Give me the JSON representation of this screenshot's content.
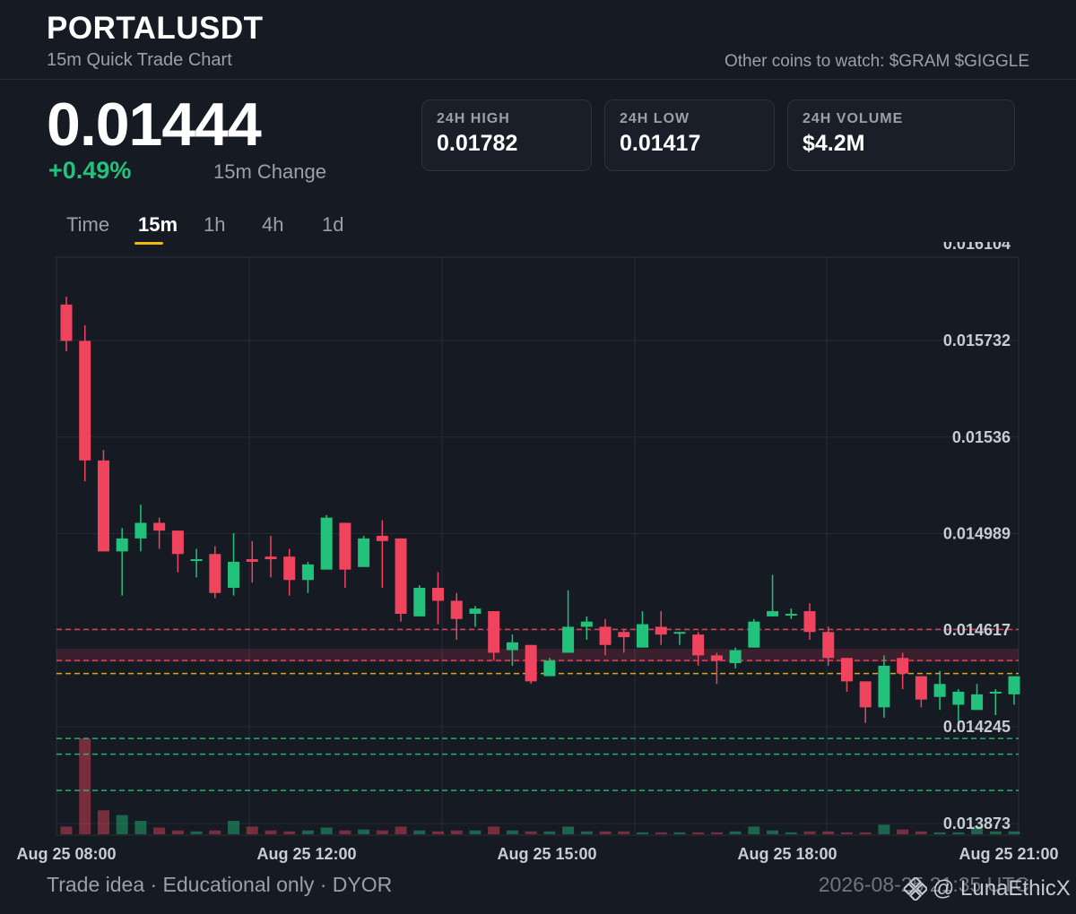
{
  "header": {
    "symbol": "PORTALUSDT",
    "subtitle": "15m Quick Trade Chart",
    "watch_text": "Other coins to watch: $GRAM $GIGGLE"
  },
  "price": {
    "last": "0.01444",
    "change": "+0.49%",
    "change_label": "15m Change"
  },
  "stats": [
    {
      "label": "24H HIGH",
      "value": "0.01782"
    },
    {
      "label": "24H LOW",
      "value": "0.01417"
    },
    {
      "label": "24H VOLUME",
      "value": "$4.2M"
    }
  ],
  "tabs": [
    {
      "label": "Time",
      "active": false
    },
    {
      "label": "15m",
      "active": true
    },
    {
      "label": "1h",
      "active": false
    },
    {
      "label": "4h",
      "active": false
    },
    {
      "label": "1d",
      "active": false
    }
  ],
  "footer": {
    "disclaimer": "Trade idea · Educational only · DYOR",
    "timestamp": "2026-08-25 21:35 UTC",
    "watermark": "@ LunaEthicX"
  },
  "colors": {
    "up": "#22c27c",
    "down": "#f0445e",
    "accent": "#f0b90b",
    "background": "#161a23"
  },
  "chart_data": {
    "type": "candlestick",
    "y_tick_labels": [
      "0.016104",
      "0.015732",
      "0.01536",
      "0.014989",
      "0.014617",
      "0.014245",
      "0.013873"
    ],
    "ylim": [
      0.013873,
      0.016104
    ],
    "grid": true,
    "x_tick_labels": [
      "Aug 25 08:00",
      "Aug 25 12:00",
      "Aug 25 15:00",
      "Aug 25 18:00",
      "Aug 25 21:00"
    ],
    "reference_lines": [
      {
        "value": 0.01462,
        "color": "#f0445e",
        "style": "dashed"
      },
      {
        "value": 0.0145,
        "color": "#f0445e",
        "style": "dashed"
      },
      {
        "value": 0.01445,
        "color": "#f0b90b",
        "style": "dashed"
      },
      {
        "value": 0.0142,
        "color": "#22c27c",
        "style": "dashed"
      },
      {
        "value": 0.01414,
        "color": "#22c27c",
        "style": "dashed"
      },
      {
        "value": 0.014,
        "color": "#22c27c",
        "style": "dashed"
      }
    ],
    "resistance_zone": [
      0.014495,
      0.014545
    ],
    "candles": [
      {
        "o": 0.01587,
        "h": 0.0159,
        "l": 0.01569,
        "c": 0.01573,
        "v": 0.08
      },
      {
        "o": 0.01573,
        "h": 0.01579,
        "l": 0.01519,
        "c": 0.01527,
        "v": 1.0
      },
      {
        "o": 0.01527,
        "h": 0.01531,
        "l": 0.01492,
        "c": 0.01492,
        "v": 0.25
      },
      {
        "o": 0.01492,
        "h": 0.01501,
        "l": 0.01475,
        "c": 0.01497,
        "v": 0.2
      },
      {
        "o": 0.01497,
        "h": 0.0151,
        "l": 0.01492,
        "c": 0.01503,
        "v": 0.14
      },
      {
        "o": 0.01503,
        "h": 0.01505,
        "l": 0.01493,
        "c": 0.015,
        "v": 0.07
      },
      {
        "o": 0.015,
        "h": 0.015,
        "l": 0.01484,
        "c": 0.01491,
        "v": 0.04
      },
      {
        "o": 0.01489,
        "h": 0.01493,
        "l": 0.01482,
        "c": 0.01489,
        "v": 0.03
      },
      {
        "o": 0.01491,
        "h": 0.01494,
        "l": 0.01474,
        "c": 0.01476,
        "v": 0.04
      },
      {
        "o": 0.01478,
        "h": 0.01499,
        "l": 0.01475,
        "c": 0.01488,
        "v": 0.14
      },
      {
        "o": 0.01489,
        "h": 0.01496,
        "l": 0.0148,
        "c": 0.01488,
        "v": 0.08
      },
      {
        "o": 0.0149,
        "h": 0.01498,
        "l": 0.01482,
        "c": 0.01489,
        "v": 0.04
      },
      {
        "o": 0.0149,
        "h": 0.01493,
        "l": 0.01475,
        "c": 0.01481,
        "v": 0.03
      },
      {
        "o": 0.01481,
        "h": 0.01488,
        "l": 0.01476,
        "c": 0.01487,
        "v": 0.04
      },
      {
        "o": 0.01485,
        "h": 0.01506,
        "l": 0.01485,
        "c": 0.01505,
        "v": 0.07
      },
      {
        "o": 0.01503,
        "h": 0.01503,
        "l": 0.01478,
        "c": 0.01485,
        "v": 0.04
      },
      {
        "o": 0.01486,
        "h": 0.01498,
        "l": 0.01486,
        "c": 0.01497,
        "v": 0.05
      },
      {
        "o": 0.01498,
        "h": 0.01504,
        "l": 0.01478,
        "c": 0.01496,
        "v": 0.04
      },
      {
        "o": 0.01497,
        "h": 0.01497,
        "l": 0.01465,
        "c": 0.01468,
        "v": 0.08
      },
      {
        "o": 0.01467,
        "h": 0.01479,
        "l": 0.01467,
        "c": 0.01478,
        "v": 0.04
      },
      {
        "o": 0.01478,
        "h": 0.01484,
        "l": 0.01464,
        "c": 0.01473,
        "v": 0.03
      },
      {
        "o": 0.01473,
        "h": 0.01476,
        "l": 0.01458,
        "c": 0.01466,
        "v": 0.04
      },
      {
        "o": 0.01468,
        "h": 0.01471,
        "l": 0.01463,
        "c": 0.0147,
        "v": 0.04
      },
      {
        "o": 0.01469,
        "h": 0.01469,
        "l": 0.0145,
        "c": 0.01453,
        "v": 0.08
      },
      {
        "o": 0.01454,
        "h": 0.0146,
        "l": 0.01448,
        "c": 0.01457,
        "v": 0.04
      },
      {
        "o": 0.01456,
        "h": 0.01456,
        "l": 0.01441,
        "c": 0.01442,
        "v": 0.03
      },
      {
        "o": 0.01444,
        "h": 0.01451,
        "l": 0.01444,
        "c": 0.0145,
        "v": 0.03
      },
      {
        "o": 0.01453,
        "h": 0.01477,
        "l": 0.01453,
        "c": 0.01463,
        "v": 0.08
      },
      {
        "o": 0.01463,
        "h": 0.01467,
        "l": 0.01458,
        "c": 0.01465,
        "v": 0.03
      },
      {
        "o": 0.01463,
        "h": 0.01466,
        "l": 0.01452,
        "c": 0.01456,
        "v": 0.03
      },
      {
        "o": 0.01461,
        "h": 0.01462,
        "l": 0.01453,
        "c": 0.01459,
        "v": 0.03
      },
      {
        "o": 0.01455,
        "h": 0.01469,
        "l": 0.01455,
        "c": 0.01464,
        "v": 0.02
      },
      {
        "o": 0.01463,
        "h": 0.01469,
        "l": 0.01456,
        "c": 0.0146,
        "v": 0.02
      },
      {
        "o": 0.01461,
        "h": 0.01461,
        "l": 0.01456,
        "c": 0.01461,
        "v": 0.02
      },
      {
        "o": 0.0146,
        "h": 0.01461,
        "l": 0.01448,
        "c": 0.01452,
        "v": 0.02
      },
      {
        "o": 0.01452,
        "h": 0.01453,
        "l": 0.01441,
        "c": 0.0145,
        "v": 0.02
      },
      {
        "o": 0.01449,
        "h": 0.01455,
        "l": 0.01447,
        "c": 0.01454,
        "v": 0.03
      },
      {
        "o": 0.01455,
        "h": 0.01466,
        "l": 0.01455,
        "c": 0.01465,
        "v": 0.08
      },
      {
        "o": 0.01467,
        "h": 0.01483,
        "l": 0.01467,
        "c": 0.01469,
        "v": 0.04
      },
      {
        "o": 0.01468,
        "h": 0.0147,
        "l": 0.01466,
        "c": 0.01468,
        "v": 0.02
      },
      {
        "o": 0.01469,
        "h": 0.01472,
        "l": 0.01458,
        "c": 0.01461,
        "v": 0.03
      },
      {
        "o": 0.01461,
        "h": 0.01463,
        "l": 0.01448,
        "c": 0.01451,
        "v": 0.03
      },
      {
        "o": 0.01451,
        "h": 0.01451,
        "l": 0.01438,
        "c": 0.01442,
        "v": 0.02
      },
      {
        "o": 0.01442,
        "h": 0.01442,
        "l": 0.01426,
        "c": 0.01432,
        "v": 0.02
      },
      {
        "o": 0.01432,
        "h": 0.01452,
        "l": 0.01428,
        "c": 0.01448,
        "v": 0.1
      },
      {
        "o": 0.01451,
        "h": 0.01453,
        "l": 0.01439,
        "c": 0.01445,
        "v": 0.05
      },
      {
        "o": 0.01444,
        "h": 0.01444,
        "l": 0.01432,
        "c": 0.01435,
        "v": 0.03
      },
      {
        "o": 0.01436,
        "h": 0.01446,
        "l": 0.01431,
        "c": 0.01441,
        "v": 0.02
      },
      {
        "o": 0.01433,
        "h": 0.01439,
        "l": 0.01426,
        "c": 0.01438,
        "v": 0.02
      },
      {
        "o": 0.01431,
        "h": 0.01441,
        "l": 0.01431,
        "c": 0.01437,
        "v": 0.08
      },
      {
        "o": 0.01438,
        "h": 0.01439,
        "l": 0.01429,
        "c": 0.01438,
        "v": 0.03
      },
      {
        "o": 0.01437,
        "h": 0.01442,
        "l": 0.01433,
        "c": 0.01444,
        "v": 0.03
      }
    ]
  }
}
